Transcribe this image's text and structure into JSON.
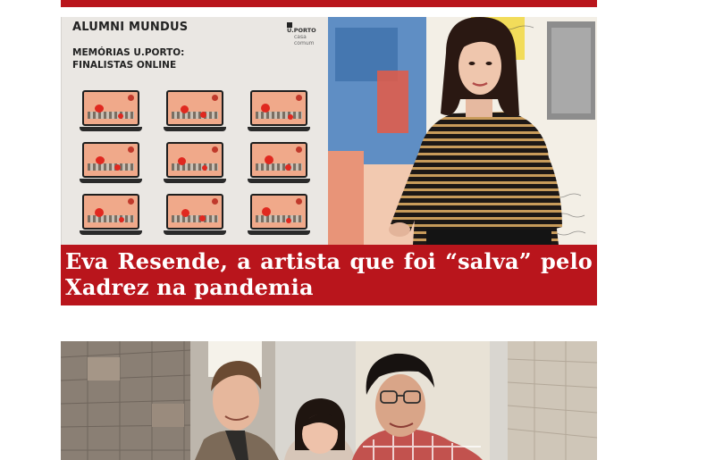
{
  "feed": {
    "articles": [
      {
        "title": "",
        "accent_color": "#b9151c"
      },
      {
        "title": "Eva Resende, a artista que foi “salva” pelo Xadrez na pandemia",
        "accent_color": "#b9151c",
        "image": {
          "poster": {
            "title": "ALUMNI MUNDUS",
            "subtitle_line1": "MEMÓRIAS U.PORTO:",
            "subtitle_line2": "FINALISTAS ONLINE",
            "logo_main": "U.PORTO",
            "logo_sub": "casa comum"
          }
        }
      },
      {
        "title": ""
      }
    ]
  }
}
